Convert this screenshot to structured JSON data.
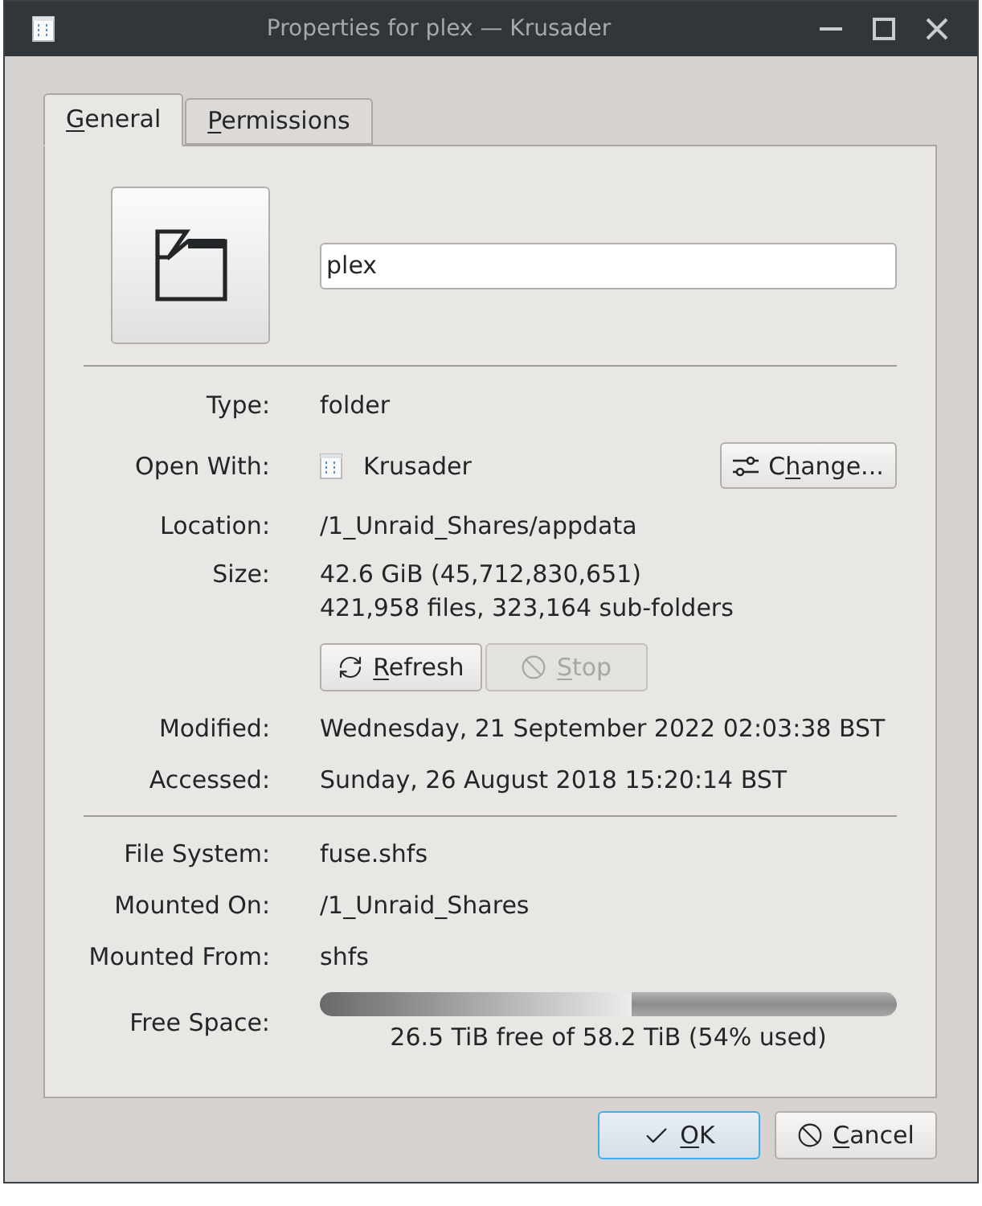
{
  "window": {
    "title": "Properties for plex — Krusader"
  },
  "tabs": [
    {
      "label": {
        "key": "G",
        "after": "eneral"
      },
      "selected": true
    },
    {
      "label": {
        "key": "P",
        "after": "ermissions"
      },
      "selected": false
    }
  ],
  "general": {
    "name": {
      "value": "plex"
    },
    "type": {
      "label": "Type:",
      "value": "folder"
    },
    "open_with": {
      "label": "Open With:",
      "value": "Krusader",
      "button": {
        "kind": "configure",
        "label": {
          "before": "C",
          "key": "h",
          "after": "ange..."
        }
      }
    },
    "location": {
      "label": "Location:",
      "value": "/1_Unraid_Shares/appdata"
    },
    "size": {
      "label": "Size:",
      "lines": [
        "42.6 GiB (45,712,830,651)",
        "421,958 files, 323,164 sub-folders"
      ],
      "buttons": [
        {
          "kind": "refresh",
          "label": {
            "key": "R",
            "after": "efresh"
          },
          "disabled": false
        },
        {
          "kind": "stop",
          "label": {
            "key": "S",
            "after": "top"
          },
          "disabled": true
        }
      ]
    },
    "times": [
      {
        "label": "Modified:",
        "value": "Wednesday, 21 September 2022 02:03:38 BST"
      },
      {
        "label": "Accessed:",
        "value": "Sunday, 26 August 2018 15:20:14 BST"
      }
    ],
    "filesystem": [
      {
        "label": "File System:",
        "value": "fuse.shfs"
      },
      {
        "label": "Mounted On:",
        "value": "/1_Unraid_Shares"
      },
      {
        "label": "Mounted From:",
        "value": "shfs"
      }
    ],
    "free_space": {
      "label": "Free Space:",
      "level": 0.54,
      "reading": "26.5 TiB free of 58.2 TiB (54% used)"
    }
  },
  "buttons": [
    {
      "kind": "ok",
      "label": {
        "key": "O",
        "after": "K"
      },
      "default": true
    },
    {
      "kind": "cancel",
      "label": {
        "key": "C",
        "after": "ancel"
      },
      "default": false
    }
  ]
}
